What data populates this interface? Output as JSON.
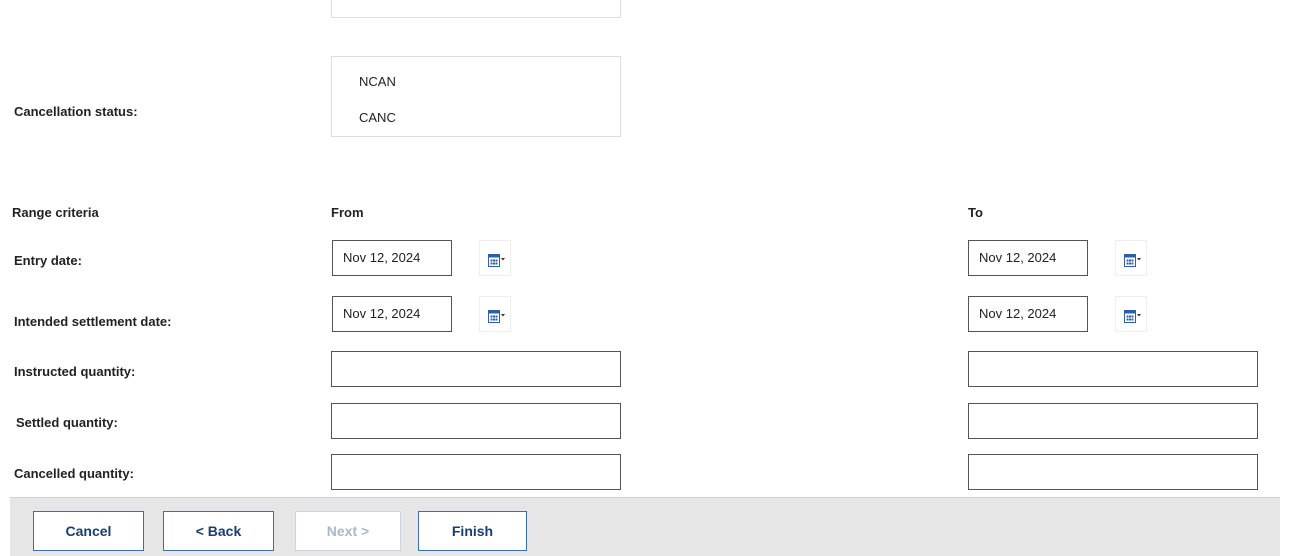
{
  "cancellation_status": {
    "label": "Cancellation status:",
    "options": [
      "NCAN",
      "CANC"
    ]
  },
  "range": {
    "header_label": "Range criteria",
    "from_label": "From",
    "to_label": "To",
    "rows": {
      "entry_date": {
        "label": "Entry date:",
        "from": "Nov 12, 2024",
        "to": "Nov 12, 2024"
      },
      "intended_settlement_date": {
        "label": "Intended settlement date:",
        "from": "Nov 12, 2024",
        "to": "Nov 12, 2024"
      },
      "instructed_quantity": {
        "label": "Instructed quantity:",
        "from": "",
        "to": ""
      },
      "settled_quantity": {
        "label": "Settled quantity:",
        "from": "",
        "to": ""
      },
      "cancelled_quantity": {
        "label": "Cancelled quantity:",
        "from": "",
        "to": ""
      }
    }
  },
  "footer": {
    "cancel": "Cancel",
    "back": "< Back",
    "next": "Next >",
    "finish": "Finish"
  },
  "colors": {
    "calendar_icon": "#2e5fa3",
    "button_border": "#3a6fb3",
    "footer_bg": "#e6e6e6"
  },
  "icons": {
    "calendar": "calendar-dropdown-icon"
  }
}
